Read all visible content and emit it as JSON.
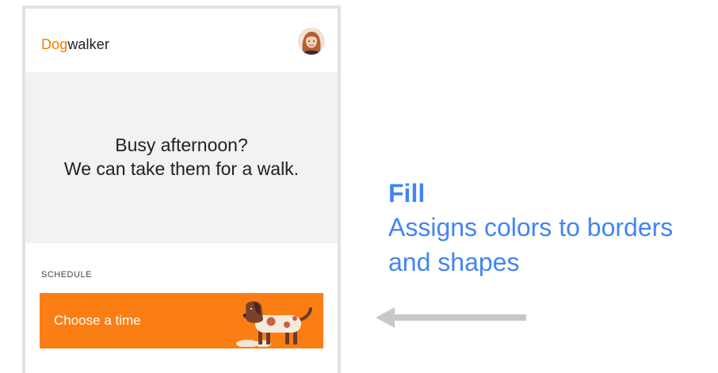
{
  "app": {
    "brand_accent": "Dog",
    "brand_rest": "walker",
    "avatar_icon": "user-avatar"
  },
  "hero": {
    "line1": "Busy afternoon?",
    "line2": "We can take them for a walk."
  },
  "schedule": {
    "section_label": "SCHEDULE",
    "cta_label": "Choose a time",
    "cta_icon": "dog-illustration"
  },
  "annotation": {
    "title": "Fill",
    "description": "Assigns colors to borders and shapes",
    "arrow_icon": "arrow-left-icon"
  },
  "colors": {
    "brand_orange": "#f57c00",
    "cta_orange": "#fb7e14",
    "hero_bg": "#f2f2f2",
    "annotation_blue": "#4285f4",
    "arrow_gray": "#c8c8c8",
    "frame_gray": "#e3e3e3"
  }
}
